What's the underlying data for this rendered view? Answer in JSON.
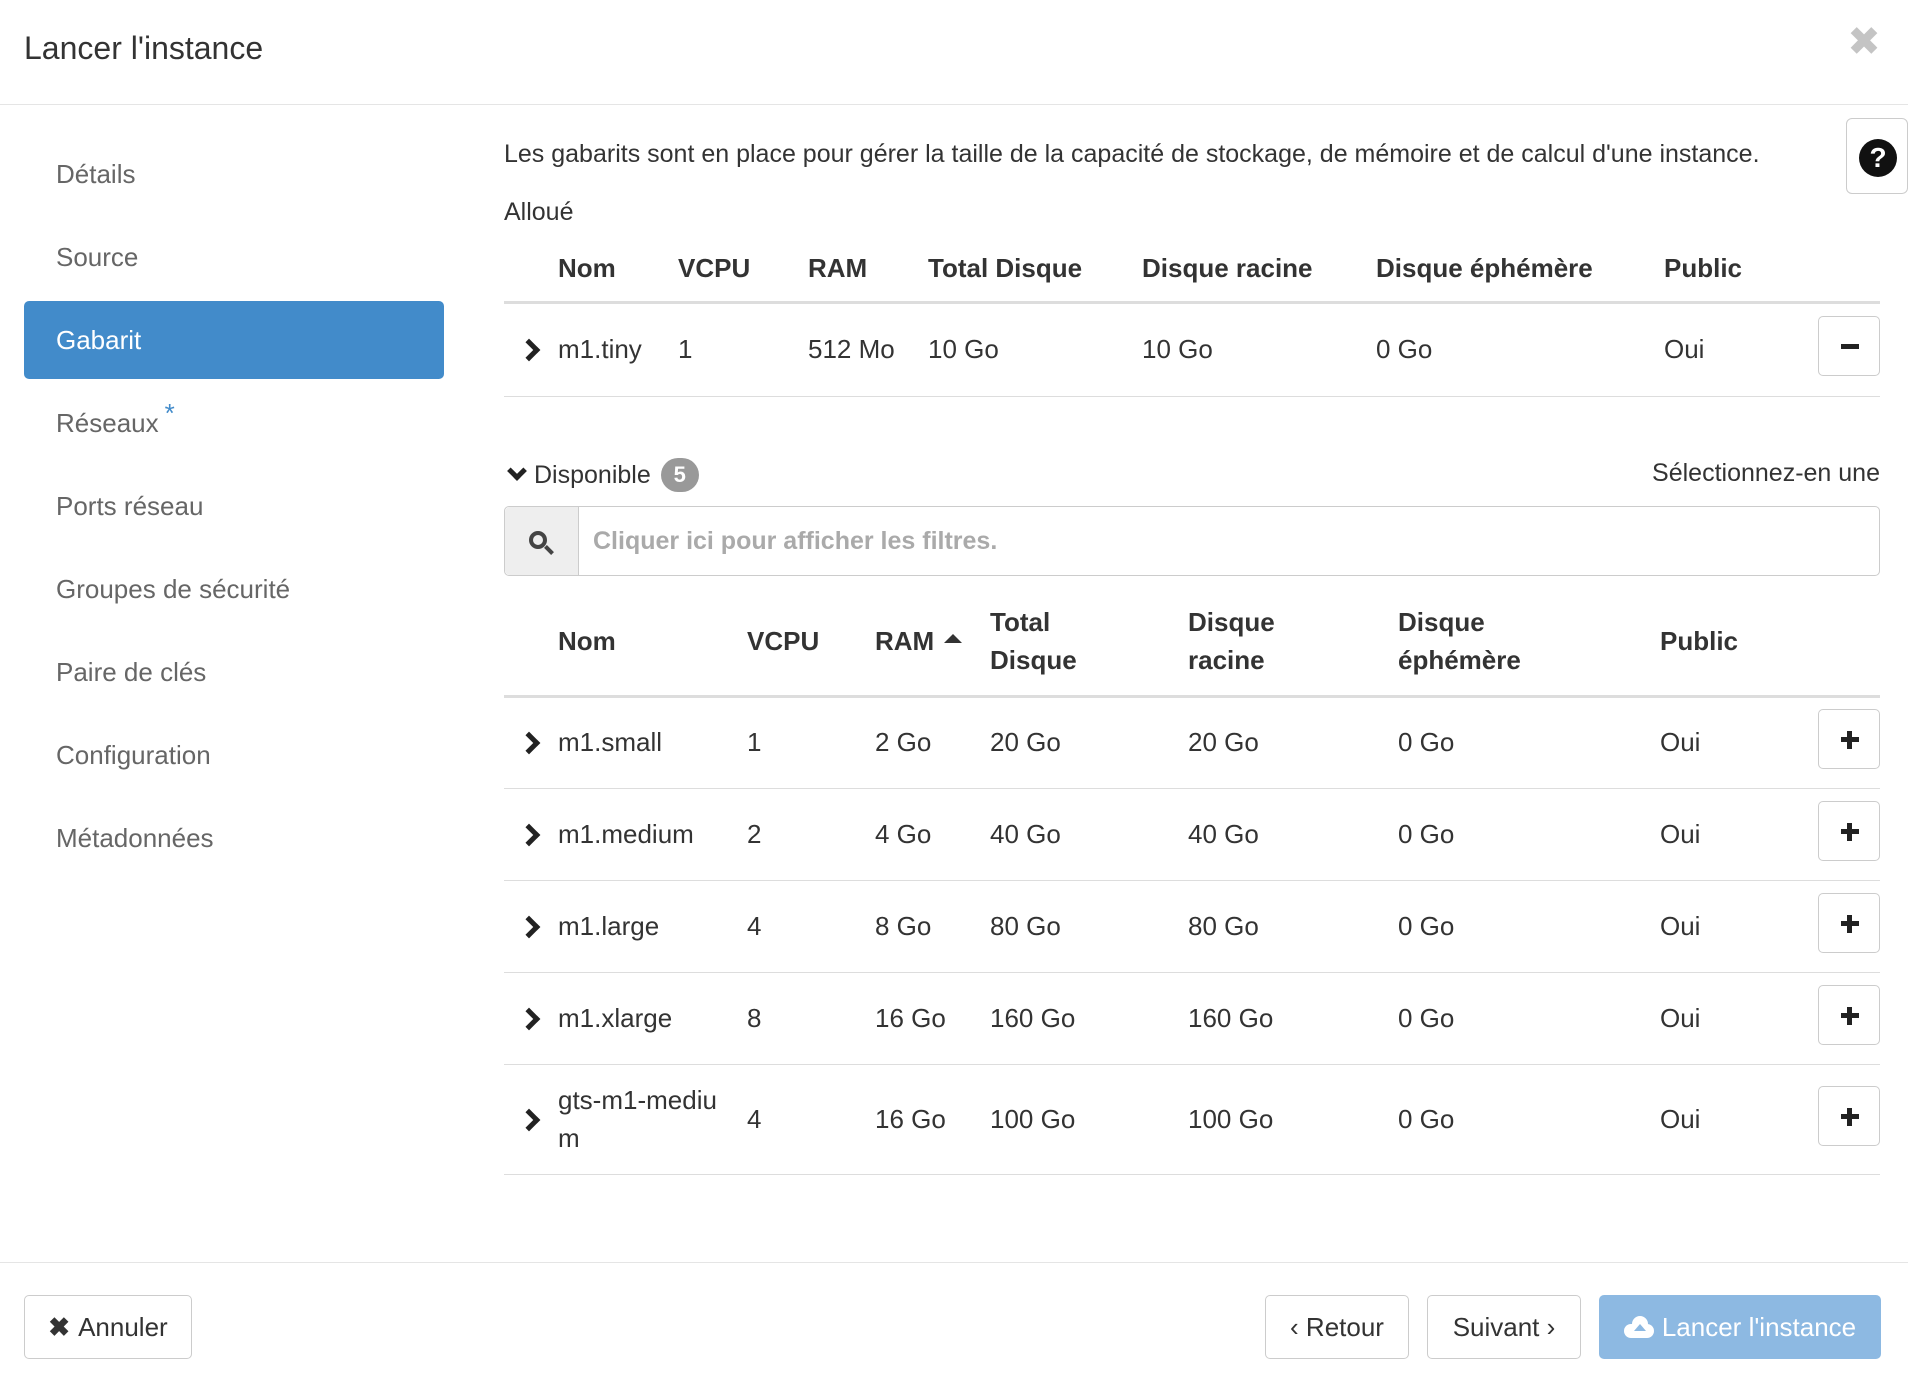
{
  "modal": {
    "title": "Lancer l'instance",
    "close_symbol": "✖"
  },
  "sidebar": {
    "items": [
      {
        "label": "Détails",
        "required": false
      },
      {
        "label": "Source",
        "required": false
      },
      {
        "label": "Gabarit",
        "required": false,
        "active": true
      },
      {
        "label": "Réseaux",
        "required": true,
        "marker": "*"
      },
      {
        "label": "Ports réseau",
        "required": false
      },
      {
        "label": "Groupes de sécurité",
        "required": false
      },
      {
        "label": "Paire de clés",
        "required": false
      },
      {
        "label": "Configuration",
        "required": false
      },
      {
        "label": "Métadonnées",
        "required": false
      }
    ]
  },
  "help": {
    "symbol": "?"
  },
  "intro": "Les gabarits sont en place pour gérer la taille de la capacité de stockage, de mémoire et de calcul d'une instance.",
  "allocated": {
    "label": "Alloué",
    "columns": [
      "Nom",
      "VCPU",
      "RAM",
      "Total Disque",
      "Disque racine",
      "Disque éphémère",
      "Public"
    ],
    "rows": [
      {
        "name": "m1.tiny",
        "vcpu": "1",
        "ram": "512 Mo",
        "total_disk": "10 Go",
        "root_disk": "10 Go",
        "ephemeral": "0 Go",
        "public": "Oui"
      }
    ]
  },
  "available": {
    "label": "Disponible",
    "count": "5",
    "hint": "Sélectionnez-en une",
    "search_placeholder": "Cliquer ici pour afficher les filtres.",
    "columns": {
      "name": "Nom",
      "vcpu": "VCPU",
      "ram": "RAM",
      "total_disk_1": "Total",
      "total_disk_2": "Disque",
      "root_disk_1": "Disque",
      "root_disk_2": "racine",
      "ephemeral_1": "Disque",
      "ephemeral_2": "éphémère",
      "public": "Public"
    },
    "rows": [
      {
        "name": "m1.small",
        "vcpu": "1",
        "ram": "2 Go",
        "total_disk": "20 Go",
        "root_disk": "20 Go",
        "ephemeral": "0 Go",
        "public": "Oui"
      },
      {
        "name": "m1.medium",
        "vcpu": "2",
        "ram": "4 Go",
        "total_disk": "40 Go",
        "root_disk": "40 Go",
        "ephemeral": "0 Go",
        "public": "Oui"
      },
      {
        "name": "m1.large",
        "vcpu": "4",
        "ram": "8 Go",
        "total_disk": "80 Go",
        "root_disk": "80 Go",
        "ephemeral": "0 Go",
        "public": "Oui"
      },
      {
        "name": "m1.xlarge",
        "vcpu": "8",
        "ram": "16 Go",
        "total_disk": "160 Go",
        "root_disk": "160 Go",
        "ephemeral": "0 Go",
        "public": "Oui"
      },
      {
        "name_1": "gts-m1-mediu",
        "name_2": "m",
        "vcpu": "4",
        "ram": "16 Go",
        "total_disk": "100 Go",
        "root_disk": "100 Go",
        "ephemeral": "0 Go",
        "public": "Oui"
      }
    ]
  },
  "footer": {
    "cancel": "Annuler",
    "cancel_icon": "✖",
    "back": "‹ Retour",
    "next": "Suivant ›",
    "launch": "Lancer l'instance"
  },
  "colors": {
    "accent": "#428bca",
    "launch_disabled": "#8db9e2",
    "badge": "#999999"
  }
}
